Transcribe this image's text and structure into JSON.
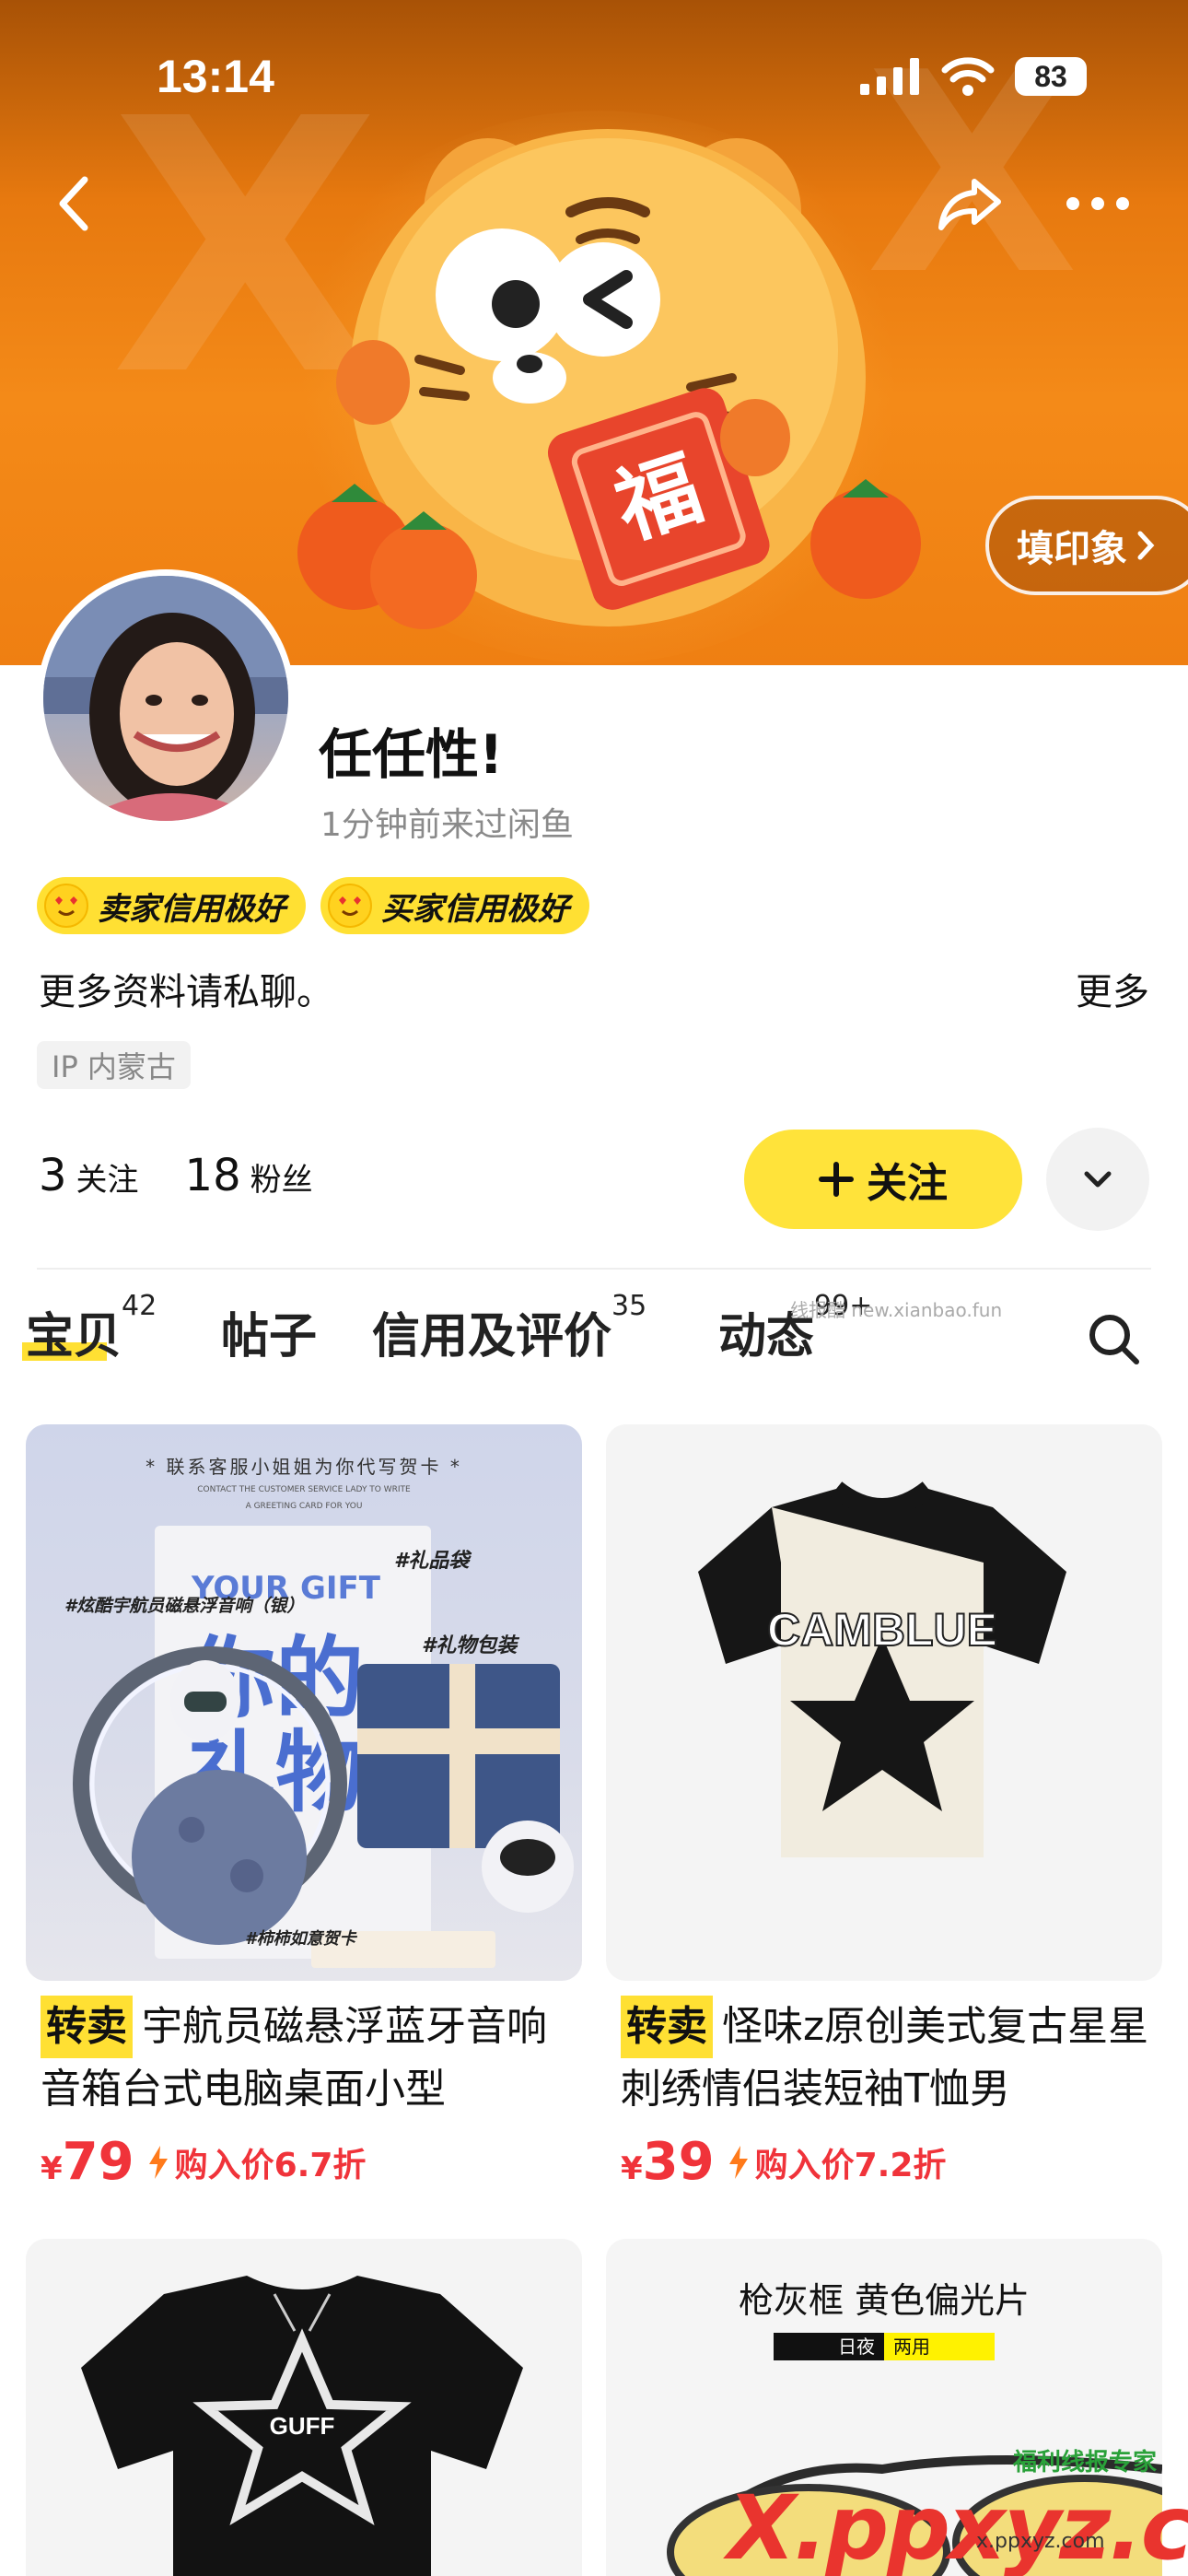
{
  "status": {
    "time": "13:14",
    "battery": "83"
  },
  "header": {
    "impression_label": "填印象"
  },
  "profile": {
    "name": "任任性!",
    "last_seen": "1分钟前来过闲鱼",
    "badges": [
      "卖家信用极好",
      "买家信用极好"
    ],
    "bio": "更多资料请私聊。",
    "more_label": "更多",
    "ip_label": "IP 内蒙古",
    "following_count": "3",
    "following_label": "关注",
    "followers_count": "18",
    "followers_label": "粉丝",
    "follow_button": "关注"
  },
  "tabs": [
    {
      "label": "宝贝",
      "count": "42"
    },
    {
      "label": "帖子",
      "count": ""
    },
    {
      "label": "信用及评价",
      "count": "35"
    },
    {
      "label": "动态",
      "count": "99+"
    }
  ],
  "tab_watermark": "线报酷 new.xianbao.fun",
  "products": [
    {
      "tag": "转卖",
      "title": "宇航员磁悬浮蓝牙音响音箱台式电脑桌面小型",
      "currency": "¥",
      "price": "79",
      "discount": "购入价6.7折",
      "image_text": {
        "top": "* 联系客服小姐姐为你代写贺卡 *",
        "sub1": "CONTACT THE CUSTOMER SERVICE LADY TO WRITE",
        "sub2": "A GREETING CARD FOR YOU",
        "gift_en": "YOUR GIFT",
        "gift_cn1": "你的",
        "gift_cn2": "礼物",
        "tag1": "#礼品袋",
        "tag2": "#炫酷宇航员磁悬浮音响（银）",
        "tag3": "#礼物包装",
        "tag4": "#柿柿如意贺卡"
      }
    },
    {
      "tag": "转卖",
      "title": "怪味z原创美式复古星星刺绣情侣装短袖T恤男",
      "currency": "¥",
      "price": "39",
      "discount": "购入价7.2折",
      "image_text": {
        "shirt": "CAMBLUE"
      }
    },
    {
      "image_text": {
        "shirt": "GUFF"
      }
    },
    {
      "image_text": {
        "title": "枪灰框 黄色偏光片",
        "left": "日夜",
        "right": "两用"
      }
    }
  ],
  "watermarks": {
    "main": "X.ppxyz.com",
    "small": "x.ppxyz.com",
    "top": "福利线报专家"
  },
  "colors": {
    "accent_yellow": "#ffe033",
    "price_red": "#f0333a",
    "banner_orange": "#f48a18"
  }
}
